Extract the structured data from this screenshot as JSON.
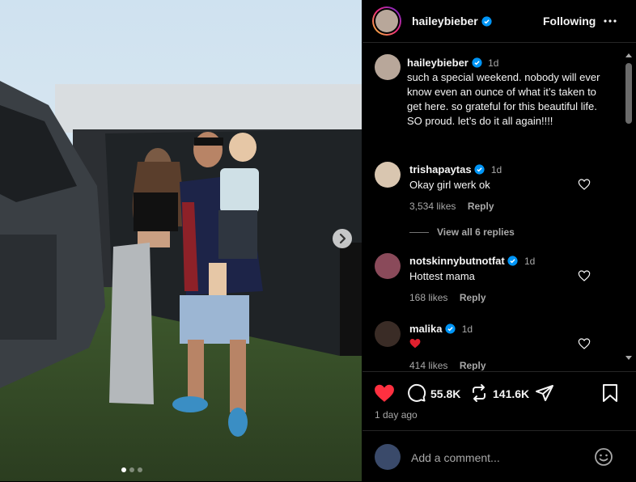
{
  "header": {
    "username": "haileybieber",
    "follow_label": "Following",
    "more_icon": "more-horizontal-icon"
  },
  "caption": {
    "username": "haileybieber",
    "time": "1d",
    "text": "such a special weekend. nobody will ever know even an ounce of what it’s taken to get here. so grateful for this beautiful life. SO proud. let’s do it all again!!!!"
  },
  "comments": [
    {
      "username": "trishapaytas",
      "time": "1d",
      "text": "Okay girl werk ok",
      "likes": "3,534 likes",
      "reply": "Reply",
      "view_replies": "View all 6 replies"
    },
    {
      "username": "notskinnybutnotfat",
      "time": "1d",
      "text": "Hottest mama",
      "likes": "168 likes",
      "reply": "Reply"
    },
    {
      "username": "malika",
      "time": "1d",
      "text": "",
      "likes": "414 likes",
      "reply": "Reply"
    }
  ],
  "actions": {
    "comments_count": "55.8K",
    "reposts_count": "141.6K",
    "posted_time": "1 day ago",
    "like_color": "#ff3040"
  },
  "add_comment": {
    "placeholder": "Add a comment..."
  },
  "colors": {
    "background": "#000000",
    "verified": "#0095f6",
    "muted": "#a8a8a8"
  }
}
